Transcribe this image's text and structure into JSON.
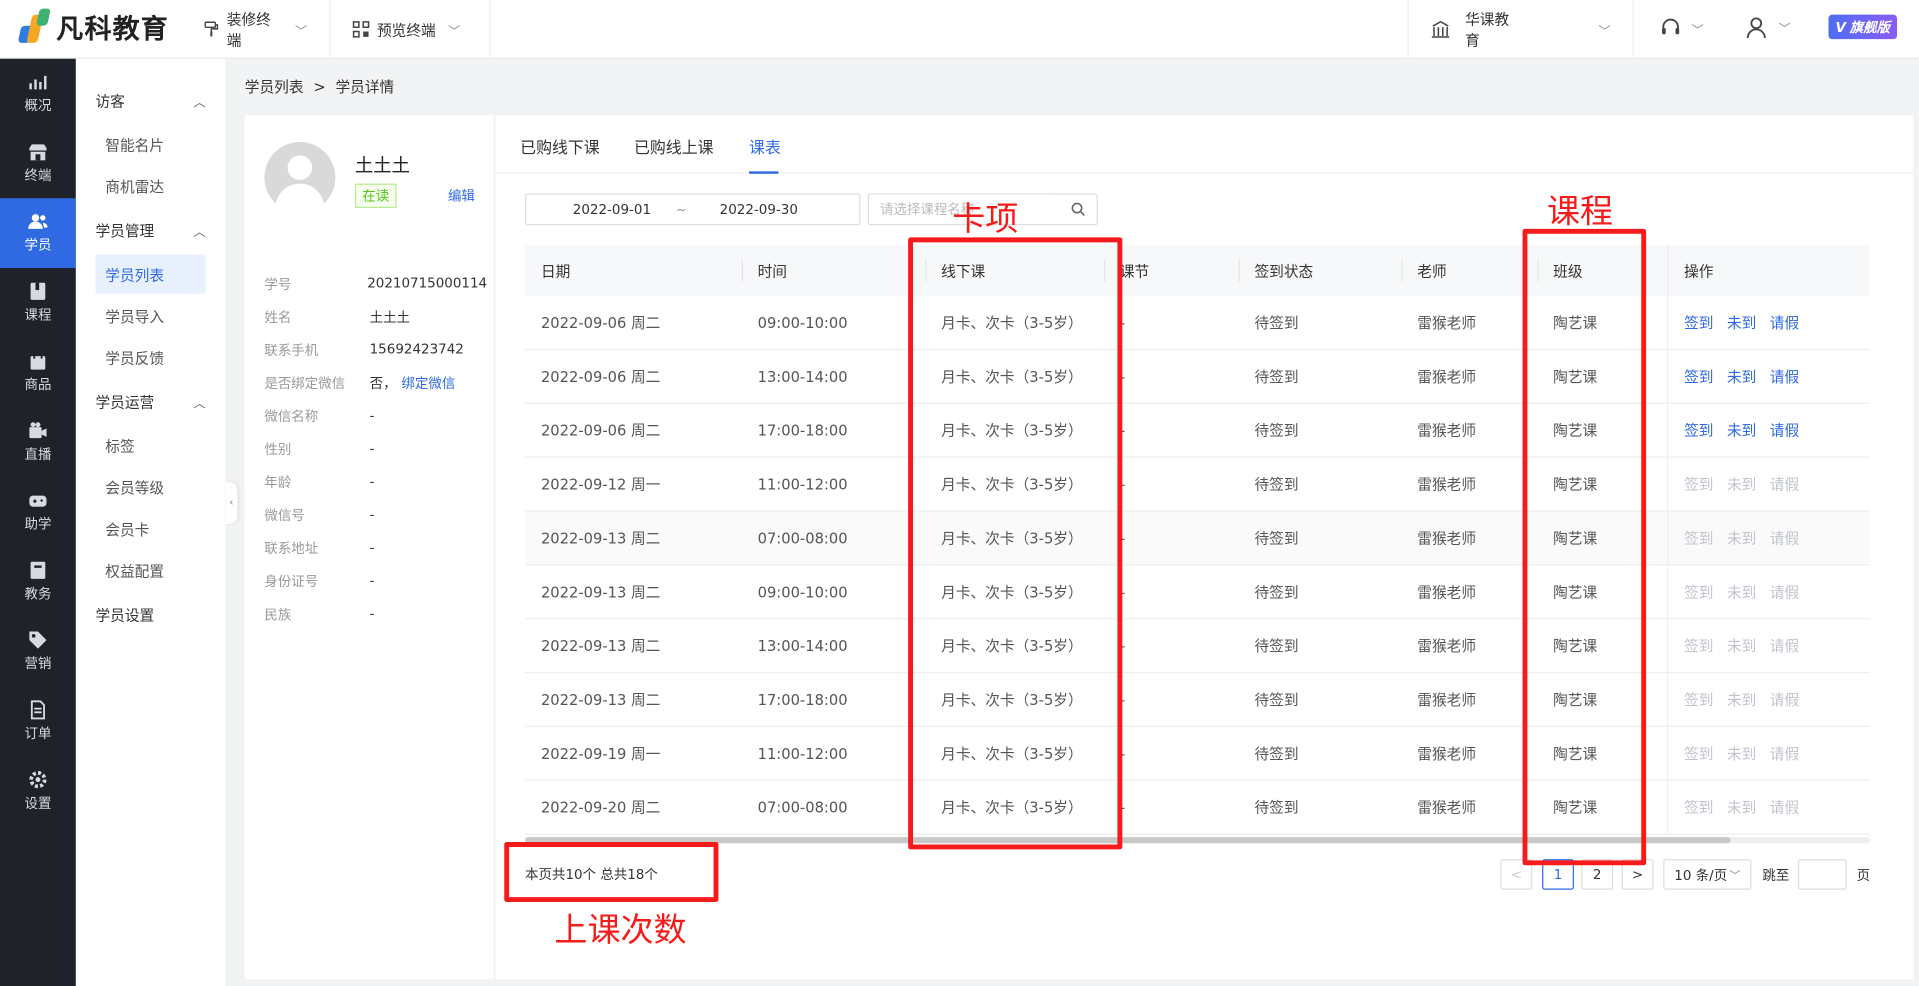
{
  "app": {
    "logo_text": "凡科教育",
    "brand_colors": {
      "primary": "#2f6ae3",
      "annotation": "#f51b1b"
    }
  },
  "topbar": {
    "decor_terminal": "装修终端",
    "preview_terminal": "预览终端",
    "org": "华课教育",
    "badge": "旗舰版"
  },
  "sidebar": {
    "items": [
      {
        "label": "概况",
        "icon": "chart-icon"
      },
      {
        "label": "终端",
        "icon": "shop-icon"
      },
      {
        "label": "学员",
        "icon": "users-icon",
        "active": true
      },
      {
        "label": "课程",
        "icon": "book-icon"
      },
      {
        "label": "商品",
        "icon": "bag-icon"
      },
      {
        "label": "直播",
        "icon": "camera-icon"
      },
      {
        "label": "助学",
        "icon": "gamepad-icon"
      },
      {
        "label": "教务",
        "icon": "clipboard-icon"
      },
      {
        "label": "营销",
        "icon": "tag-icon"
      },
      {
        "label": "订单",
        "icon": "receipt-icon"
      },
      {
        "label": "设置",
        "icon": "gear-icon"
      }
    ]
  },
  "submenu": {
    "groups": [
      {
        "title": "访客",
        "items": [
          "智能名片",
          "商机雷达"
        ]
      },
      {
        "title": "学员管理",
        "items": [
          "学员列表",
          "学员导入",
          "学员反馈"
        ]
      },
      {
        "title": "学员运营",
        "items": [
          "标签",
          "会员等级",
          "会员卡",
          "权益配置"
        ]
      }
    ],
    "settings": "学员设置",
    "active": "学员列表"
  },
  "breadcrumb": {
    "parent": "学员列表",
    "sep": ">",
    "current": "学员详情"
  },
  "student": {
    "name": "土土土",
    "status": "在读",
    "edit": "编辑",
    "fields": [
      {
        "k": "学号",
        "v": "20210715000114"
      },
      {
        "k": "姓名",
        "v": "土土土"
      },
      {
        "k": "联系手机",
        "v": "15692423742"
      },
      {
        "k": "是否绑定微信",
        "v": "否，",
        "link": "绑定微信"
      },
      {
        "k": "微信名称",
        "v": "-"
      },
      {
        "k": "性别",
        "v": "-"
      },
      {
        "k": "年龄",
        "v": "-"
      },
      {
        "k": "微信号",
        "v": "-"
      },
      {
        "k": "联系地址",
        "v": "-"
      },
      {
        "k": "身份证号",
        "v": "-"
      },
      {
        "k": "民族",
        "v": "-"
      }
    ]
  },
  "tabs": [
    "已购线下课",
    "已购线上课",
    "课表"
  ],
  "filters": {
    "date_start": "2022-09-01",
    "date_sep": "~",
    "date_end": "2022-09-30",
    "search_placeholder": "请选择课程名称"
  },
  "table": {
    "headers": [
      "日期",
      "时间",
      "线下课",
      "课节",
      "签到状态",
      "老师",
      "班级",
      "操作"
    ],
    "rows": [
      {
        "date": "2022-09-06 周二",
        "time": "09:00-10:00",
        "course": "月卡、次卡（3-5岁）",
        "lesson": "-",
        "status": "待签到",
        "teacher": "雷猴老师",
        "class": "陶艺课",
        "enabled": true
      },
      {
        "date": "2022-09-06 周二",
        "time": "13:00-14:00",
        "course": "月卡、次卡（3-5岁）",
        "lesson": "-",
        "status": "待签到",
        "teacher": "雷猴老师",
        "class": "陶艺课",
        "enabled": true
      },
      {
        "date": "2022-09-06 周二",
        "time": "17:00-18:00",
        "course": "月卡、次卡（3-5岁）",
        "lesson": "-",
        "status": "待签到",
        "teacher": "雷猴老师",
        "class": "陶艺课",
        "enabled": true
      },
      {
        "date": "2022-09-12 周一",
        "time": "11:00-12:00",
        "course": "月卡、次卡（3-5岁）",
        "lesson": "-",
        "status": "待签到",
        "teacher": "雷猴老师",
        "class": "陶艺课",
        "enabled": false
      },
      {
        "date": "2022-09-13 周二",
        "time": "07:00-08:00",
        "course": "月卡、次卡（3-5岁）",
        "lesson": "-",
        "status": "待签到",
        "teacher": "雷猴老师",
        "class": "陶艺课",
        "enabled": false
      },
      {
        "date": "2022-09-13 周二",
        "time": "09:00-10:00",
        "course": "月卡、次卡（3-5岁）",
        "lesson": "-",
        "status": "待签到",
        "teacher": "雷猴老师",
        "class": "陶艺课",
        "enabled": false
      },
      {
        "date": "2022-09-13 周二",
        "time": "13:00-14:00",
        "course": "月卡、次卡（3-5岁）",
        "lesson": "-",
        "status": "待签到",
        "teacher": "雷猴老师",
        "class": "陶艺课",
        "enabled": false
      },
      {
        "date": "2022-09-13 周二",
        "time": "17:00-18:00",
        "course": "月卡、次卡（3-5岁）",
        "lesson": "-",
        "status": "待签到",
        "teacher": "雷猴老师",
        "class": "陶艺课",
        "enabled": false
      },
      {
        "date": "2022-09-19 周一",
        "time": "11:00-12:00",
        "course": "月卡、次卡（3-5岁）",
        "lesson": "-",
        "status": "待签到",
        "teacher": "雷猴老师",
        "class": "陶艺课",
        "enabled": false
      },
      {
        "date": "2022-09-20 周二",
        "time": "07:00-08:00",
        "course": "月卡、次卡（3-5岁）",
        "lesson": "-",
        "status": "待签到",
        "teacher": "雷猴老师",
        "class": "陶艺课",
        "enabled": false
      }
    ],
    "actions": [
      "签到",
      "未到",
      "请假"
    ]
  },
  "footer": {
    "count": "本页共10个 总共18个",
    "prev": "<",
    "next": ">",
    "pages": [
      "1",
      "2"
    ],
    "current_page": "1",
    "page_size": "10 条/页",
    "jump_label": "跳至",
    "page_suffix": "页"
  },
  "annotations": {
    "card_item": "卡项",
    "course": "课程",
    "class_count": "上课次数"
  }
}
